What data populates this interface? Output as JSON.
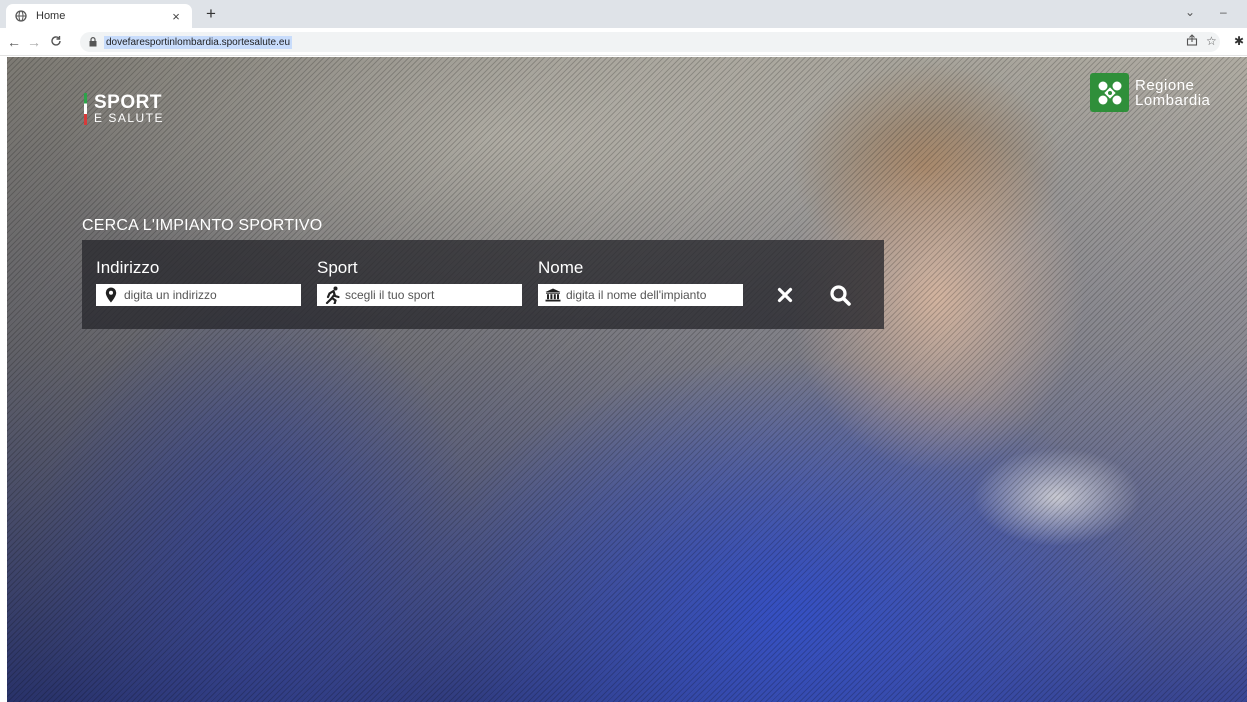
{
  "browser": {
    "tab_title": "Home",
    "tab_close": "×",
    "new_tab": "+",
    "url": "dovefaresportinlombardia.sportesalute.eu",
    "min_glyph": "–",
    "chevron_glyph": "⌄"
  },
  "header": {
    "logo_top": "SPORT",
    "logo_bottom": "E SALUTE",
    "region_line1": "Regione",
    "region_line2": "Lombardia"
  },
  "search": {
    "title": "CERCA L'IMPIANTO SPORTIVO",
    "fields": [
      {
        "label": "Indirizzo",
        "placeholder": "digita un indirizzo",
        "icon": "map-marker-icon"
      },
      {
        "label": "Sport",
        "placeholder": "scegli il tuo sport",
        "icon": "runner-icon"
      },
      {
        "label": "Nome",
        "placeholder": "digita il nome dell'impianto",
        "icon": "building-icon"
      }
    ]
  },
  "colors": {
    "region_green": "#2f8f3a",
    "panel_bg": "rgba(40,40,45,0.78)",
    "url_highlight": "#c8dcfb"
  }
}
